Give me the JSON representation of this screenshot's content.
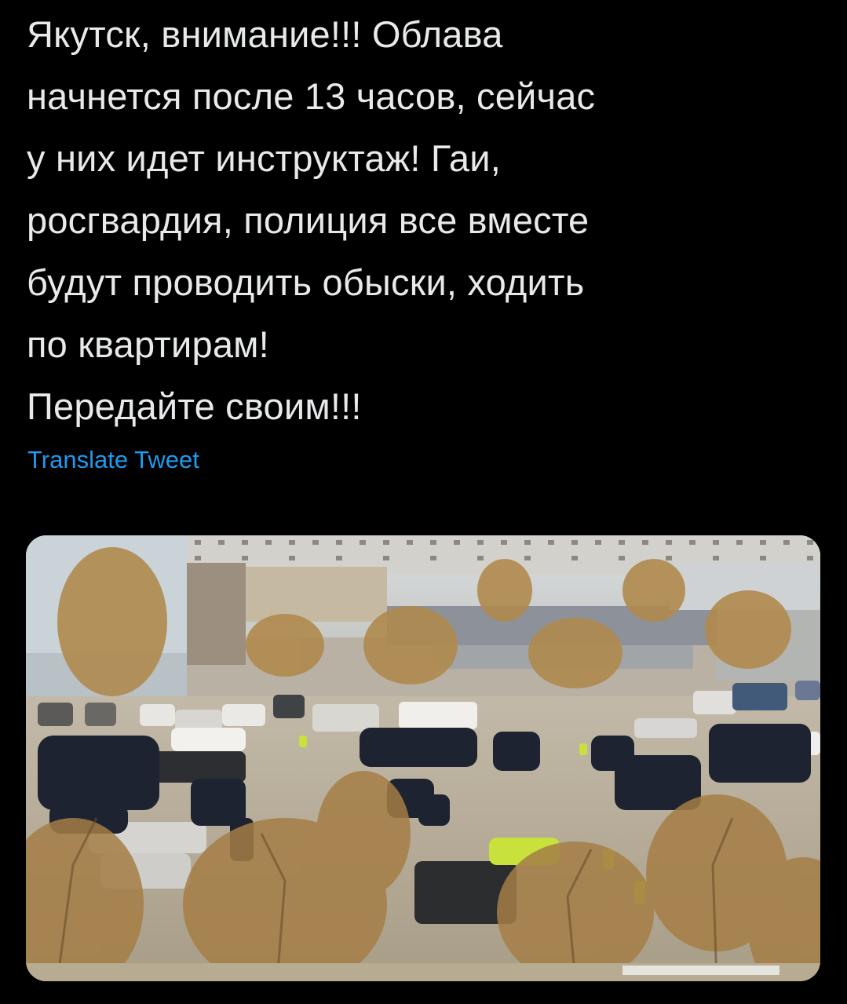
{
  "tweet": {
    "text_lines": [
      "Якутск, внимание!!! Облава",
      "начнется после 13 часов, сейчас",
      "у них идет инструктаж! Гаи,",
      "росгвардия, полиция все вместе",
      "будут проводить обыски, ходить",
      "по квартирам!",
      "Передайте своим!!!"
    ],
    "translate_label": "Translate Tweet"
  },
  "colors": {
    "background": "#000000",
    "text": "#e7e9ea",
    "link": "#1d9bf0"
  },
  "media": {
    "kind": "photo",
    "alt_subject": "crowd-of-police-in-parking-lot"
  }
}
